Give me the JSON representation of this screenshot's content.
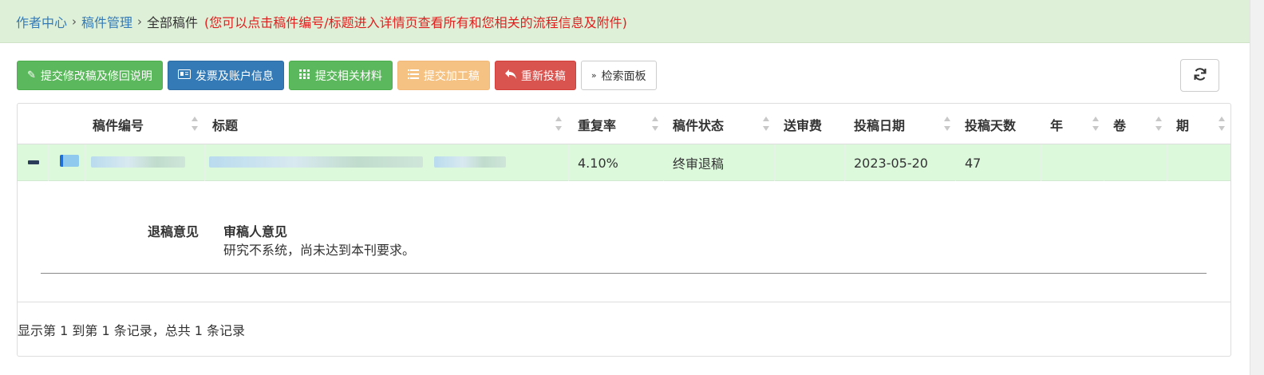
{
  "breadcrumb": {
    "home": "作者中心",
    "manage": "稿件管理",
    "current": "全部稿件",
    "hint": "(您可以点击稿件编号/标题进入详情页查看所有和您相关的流程信息及附件)"
  },
  "toolbar": {
    "submit_revision": "提交修改稿及修回说明",
    "invoice": "发票及账户信息",
    "submit_materials": "提交相关材料",
    "submit_processing": "提交加工稿",
    "resubmit": "重新投稿",
    "search_panel": "检索面板"
  },
  "table": {
    "headers": {
      "id": "稿件编号",
      "title": "标题",
      "dup_rate": "重复率",
      "status": "稿件状态",
      "fee": "送审费",
      "date": "投稿日期",
      "days": "投稿天数",
      "year": "年",
      "volume": "卷",
      "issue": "期"
    },
    "row": {
      "dup_rate": "4.10%",
      "status": "终审退稿",
      "fee": "",
      "date": "2023-05-20",
      "days": "47",
      "year": "",
      "volume": "",
      "issue": ""
    },
    "detail": {
      "label": "退稿意见",
      "title": "审稿人意见",
      "text": "研究不系统，尚未达到本刊要求。"
    }
  },
  "pagination": {
    "info": "显示第 1 到第 1 条记录，总共 1 条记录"
  },
  "icons": {
    "refresh": "refresh-icon",
    "edit": "edit-icon",
    "card": "id-card-icon",
    "grid": "grid-icon",
    "list": "list-icon",
    "reply": "reply-icon",
    "chevron": "double-chevron-down-icon"
  }
}
